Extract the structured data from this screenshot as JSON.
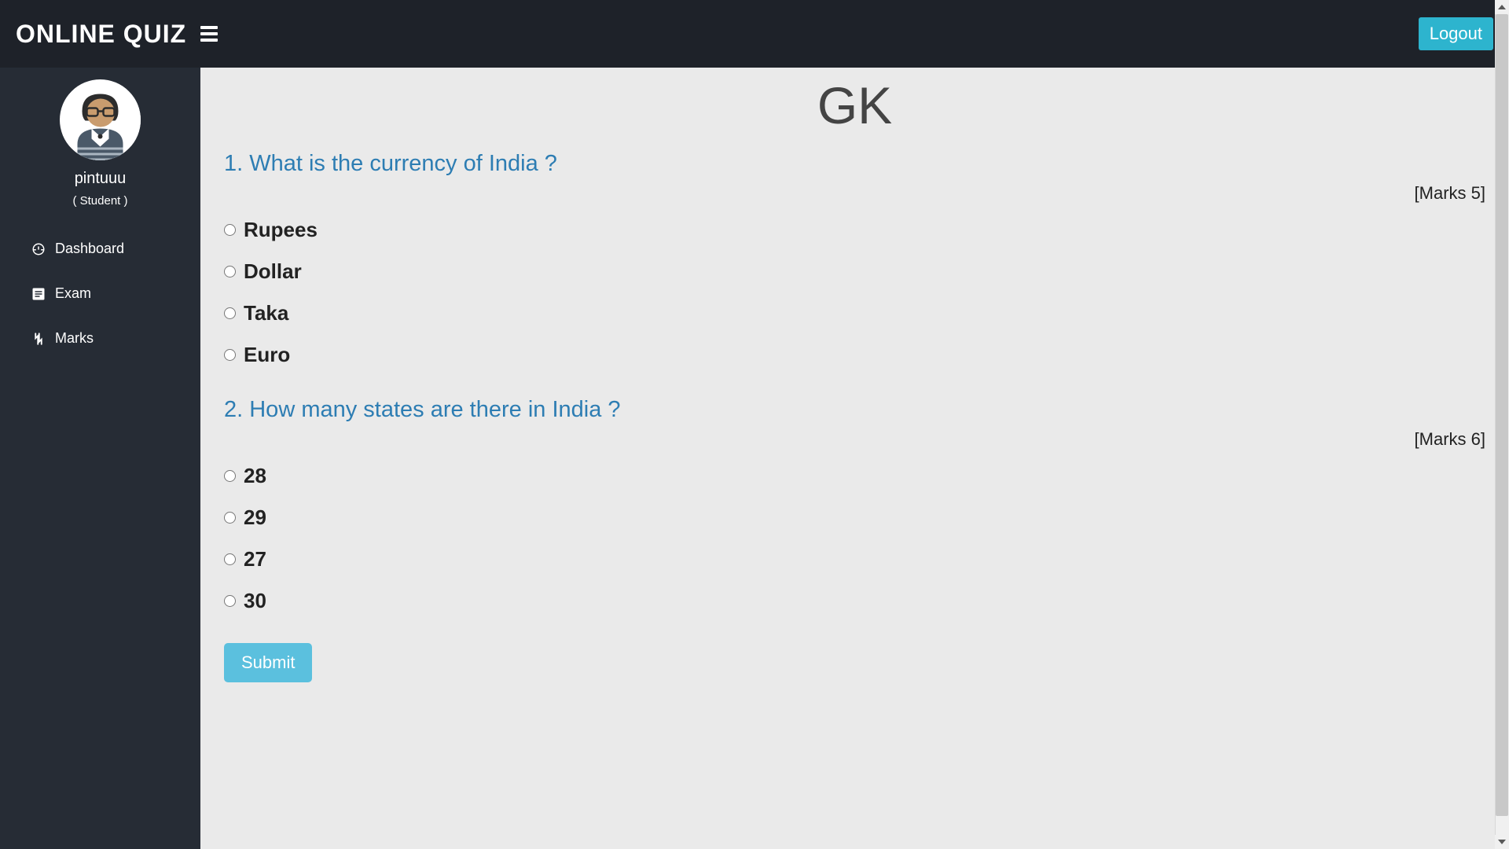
{
  "header": {
    "logo": "ONLINE QUIZ",
    "logout_label": "Logout"
  },
  "sidebar": {
    "username": "pintuuu",
    "role": "( Student )",
    "nav": [
      {
        "icon": "dashboard-icon",
        "label": "Dashboard"
      },
      {
        "icon": "exam-icon",
        "label": "Exam"
      },
      {
        "icon": "marks-icon",
        "label": "Marks"
      }
    ]
  },
  "main": {
    "title": "GK",
    "questions": [
      {
        "text": "1. What is the currency of India ?",
        "marks": "[Marks 5]",
        "options": [
          "Rupees",
          "Dollar",
          "Taka",
          "Euro"
        ]
      },
      {
        "text": "2. How many states are there in India ?",
        "marks": "[Marks 6]",
        "options": [
          "28",
          "29",
          "27",
          "30"
        ]
      }
    ],
    "submit_label": "Submit"
  }
}
